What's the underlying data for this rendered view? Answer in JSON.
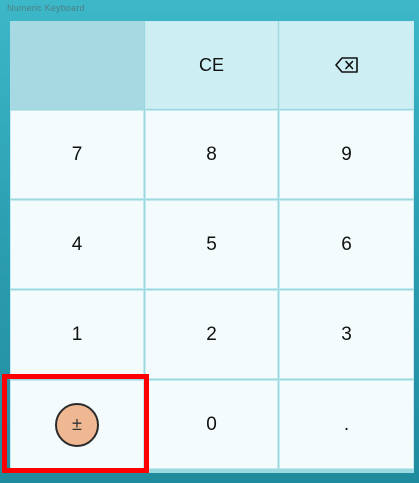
{
  "window": {
    "title": "Numeric Keyboard"
  },
  "keys": {
    "clear_entry": "CE",
    "backspace_icon": "backspace-icon",
    "seven": "7",
    "eight": "8",
    "nine": "9",
    "four": "4",
    "five": "5",
    "six": "6",
    "one": "1",
    "two": "2",
    "three": "3",
    "plus_minus": "±",
    "zero": "0",
    "decimal": "."
  },
  "colors": {
    "frame": "#2fa3b5",
    "key_background": "#f3fbfd",
    "top_row_background": "#cdeef3",
    "plus_minus_fill": "#f0b892",
    "highlight": "#ff0000"
  }
}
